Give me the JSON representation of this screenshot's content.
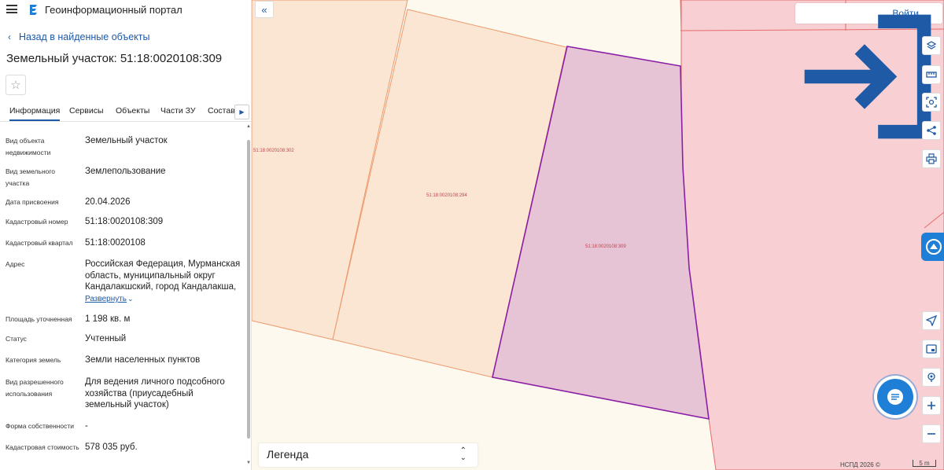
{
  "header": {
    "app_title": "Геоинформационный портал"
  },
  "sidebar": {
    "back_link": "Назад в найденные объекты",
    "title": "Земельный участок: 51:18:0020108:309",
    "tabs": [
      {
        "label": "Информация",
        "active": true
      },
      {
        "label": "Сервисы",
        "active": false
      },
      {
        "label": "Объекты",
        "active": false
      },
      {
        "label": "Части ЗУ",
        "active": false
      },
      {
        "label": "Состав",
        "active": false
      }
    ],
    "info": [
      {
        "label": "Вид объекта недвижимости",
        "value": "Земельный участок"
      },
      {
        "label": "Вид земельного участка",
        "value": "Землепользование"
      },
      {
        "label": "Дата присвоения",
        "value": "20.04.2026"
      },
      {
        "label": "Кадастровый номер",
        "value": "51:18:0020108:309"
      },
      {
        "label": "Кадастровый квартал",
        "value": "51:18:0020108"
      },
      {
        "label": "Адрес",
        "value": "Российская Федерация, Мурманская область, муниципальный округ Кандалакшский, город Кандалакша,",
        "expand": "Развернуть"
      },
      {
        "label": "Площадь уточненная",
        "value": "1 198 кв. м"
      },
      {
        "label": "Статус",
        "value": "Учтенный"
      },
      {
        "label": "Категория земель",
        "value": "Земли населенных пунктов"
      },
      {
        "label": "Вид разрешенного использования",
        "value": "Для ведения личного подсобного хозяйства (приусадебный земельный участок)"
      },
      {
        "label": "Форма собственности",
        "value": "-"
      },
      {
        "label": "Кадастровая стоимость",
        "value": "578 035 руб."
      }
    ]
  },
  "map": {
    "login_label": "Войти",
    "parcel_labels": {
      "p302": "51:18:0020108:302",
      "p294": "51:18:0020108:294",
      "p309": "51:18:0020108:309"
    },
    "legend_label": "Легенда",
    "attribution": "НСПД 2026 ©",
    "scale_label": "5 m",
    "colors": {
      "parcel_fill": "#fbe6d3",
      "parcel_stroke": "#ec9a6d",
      "selected_fill": "#e7c3d6",
      "selected_stroke": "#8a1fa6",
      "zone_fill": "#f8d0d3",
      "zone_stroke": "#e86a6a",
      "accent": "#1f5aa6"
    },
    "tools": [
      "layers-icon",
      "ruler-icon",
      "select-area-icon",
      "share-icon",
      "print-icon",
      "navigate-icon",
      "minimap-icon",
      "locate-icon",
      "zoom-in-icon",
      "zoom-out-icon"
    ]
  }
}
